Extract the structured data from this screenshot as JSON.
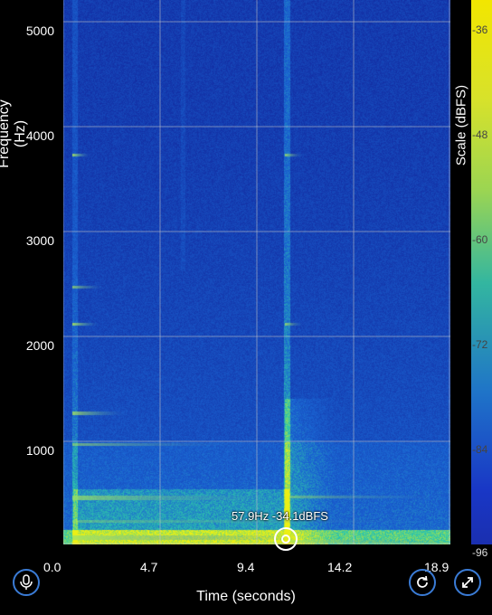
{
  "axes": {
    "ylabel": "Frequency (Hz)",
    "xlabel": "Time (seconds)",
    "yticks": [
      "5000",
      "4000",
      "3000",
      "2000",
      "1000"
    ],
    "xticks": [
      "0.0",
      "4.7",
      "9.4",
      "14.2",
      "18.9"
    ]
  },
  "scale": {
    "label": "Scale (dBFS)",
    "ticks": [
      "-36",
      "-48",
      "-60",
      "-72",
      "-84",
      "-96"
    ]
  },
  "cursor": {
    "readout": "57.9Hz -34.1dBFS"
  },
  "icons": {
    "mic": "microphone-icon",
    "refresh": "refresh-icon",
    "expand": "expand-icon"
  }
}
